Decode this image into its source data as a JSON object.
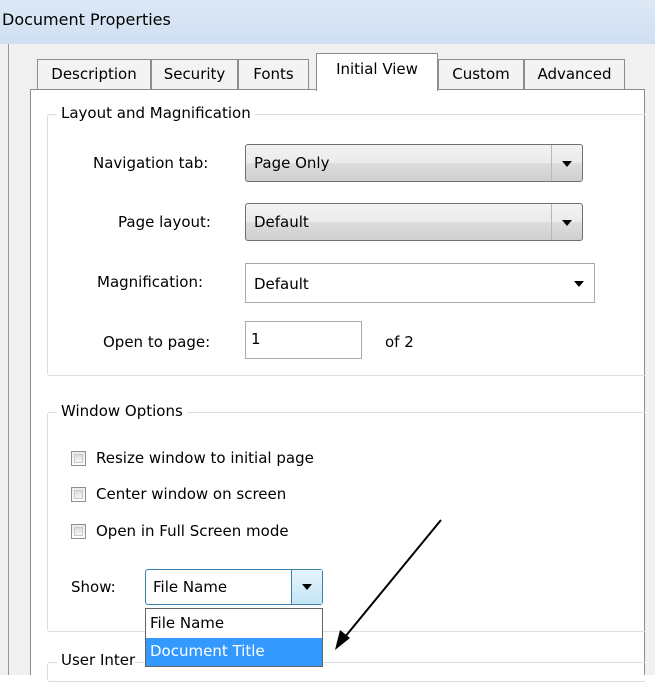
{
  "window": {
    "title": "Document Properties"
  },
  "tabs": [
    {
      "label": "Description",
      "active": false
    },
    {
      "label": "Security",
      "active": false
    },
    {
      "label": "Fonts",
      "active": false
    },
    {
      "label": "Initial View",
      "active": true
    },
    {
      "label": "Custom",
      "active": false
    },
    {
      "label": "Advanced",
      "active": false
    }
  ],
  "layout_magnification": {
    "group_title": "Layout and Magnification",
    "navigation_tab": {
      "label": "Navigation tab:",
      "value": "Page Only"
    },
    "page_layout": {
      "label": "Page layout:",
      "value": "Default"
    },
    "magnification": {
      "label": "Magnification:",
      "value": "Default"
    },
    "open_to_page": {
      "label": "Open to page:",
      "value": "1",
      "suffix": "of 2"
    }
  },
  "window_options": {
    "group_title": "Window Options",
    "checkboxes": [
      {
        "label": "Resize window to initial page",
        "checked": false
      },
      {
        "label": "Center window on screen",
        "checked": false
      },
      {
        "label": "Open in Full Screen mode",
        "checked": false
      }
    ],
    "show": {
      "label": "Show:",
      "value": "File Name",
      "options": [
        "File Name",
        "Document Title"
      ],
      "highlighted": "Document Title"
    }
  },
  "user_interface": {
    "group_title_partial": "User Inter"
  },
  "colors": {
    "selection": "#3399ff",
    "annotation_arrow": "#000000"
  }
}
